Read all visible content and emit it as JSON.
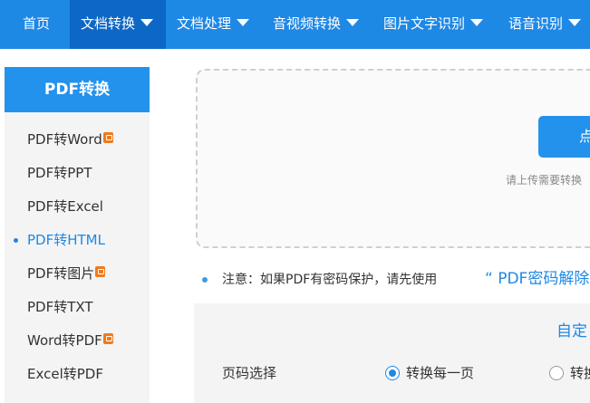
{
  "nav": {
    "items": [
      {
        "label": "首页"
      },
      {
        "label": "文档转换"
      },
      {
        "label": "文档处理"
      },
      {
        "label": "音视频转换"
      },
      {
        "label": "图片文字识别"
      },
      {
        "label": "语音识别"
      }
    ],
    "active": "文档转换"
  },
  "sidebar": {
    "title": "PDF转换",
    "items": [
      {
        "label": "PDF转Word",
        "badge": true
      },
      {
        "label": "PDF转PPT"
      },
      {
        "label": "PDF转Excel"
      },
      {
        "label": "PDF转HTML",
        "active": true
      },
      {
        "label": "PDF转图片",
        "badge": true
      },
      {
        "label": "PDF转TXT"
      },
      {
        "label": "Word转PDF",
        "badge": true
      },
      {
        "label": "Excel转PDF"
      }
    ]
  },
  "upload": {
    "button_label": "点",
    "hint": "请上传需要转换"
  },
  "notice": {
    "text": "注意：如果PDF有密码保护，请先使用",
    "link": "“ PDF密码解除"
  },
  "settings": {
    "custom_link": "自定",
    "page_label": "页码选择",
    "options": [
      {
        "label": "转换每一页",
        "checked": true
      },
      {
        "label": "转换"
      }
    ]
  },
  "colors": {
    "nav_bg": "#1e88e5",
    "nav_active": "#0d67c6",
    "accent": "#2392ec",
    "badge": "#f07a1a"
  }
}
